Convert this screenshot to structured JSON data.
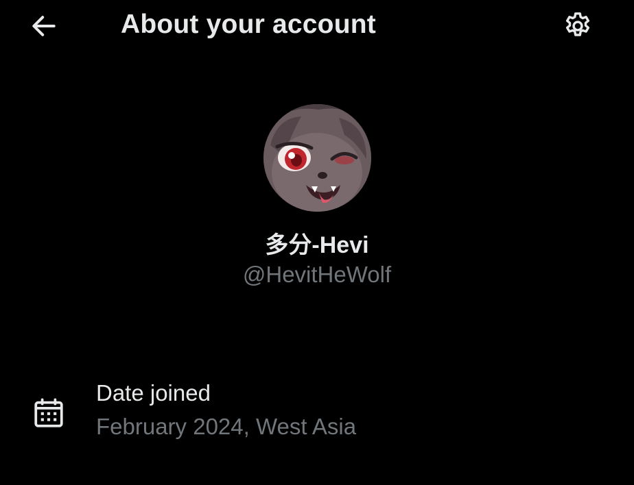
{
  "header": {
    "title": "About your account",
    "back_icon": "arrow-left-icon",
    "settings_icon": "gear-icon"
  },
  "profile": {
    "display_name": "多分-Hevi",
    "handle": "@HevitHeWolf",
    "avatar_icon": "avatar"
  },
  "details": [
    {
      "icon": "calendar-icon",
      "title": "Date joined",
      "value": "February 2024, West Asia"
    }
  ],
  "colors": {
    "background": "#000000",
    "primary_text": "#e7e9ea",
    "secondary_text": "#71767b"
  }
}
